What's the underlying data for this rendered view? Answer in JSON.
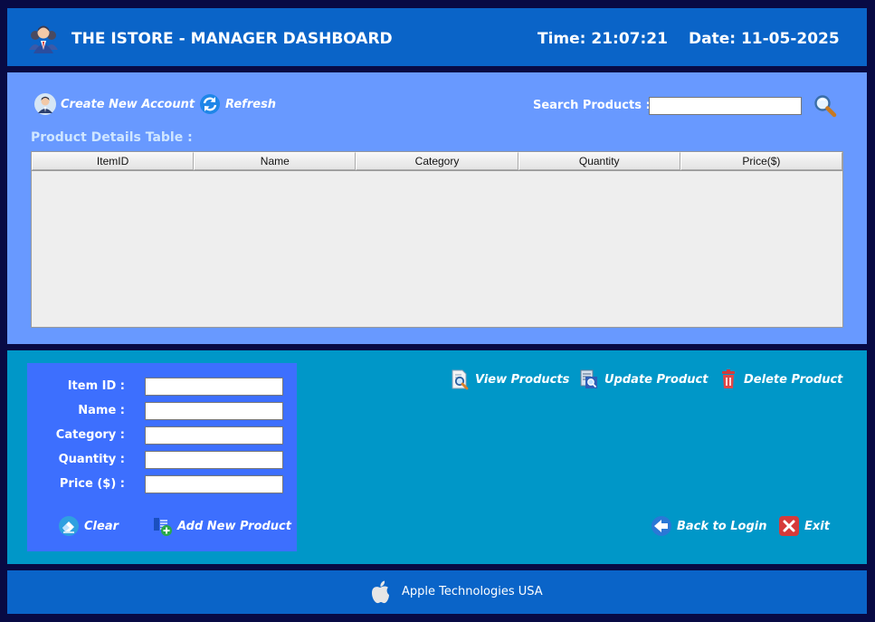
{
  "header": {
    "title": "THE ISTORE - MANAGER DASHBOARD",
    "time": "Time: 21:07:21",
    "date": "Date: 11-05-2025",
    "logo_icon": "manager-team-icon"
  },
  "toolbar": {
    "create_account_label": "Create New Account",
    "create_account_icon": "user-avatar-icon",
    "refresh_label": "Refresh",
    "refresh_icon": "refresh-icon",
    "search_label": "Search Products :",
    "search_value": "",
    "search_icon": "magnifier-icon"
  },
  "table": {
    "title": "Product Details Table :",
    "columns": [
      "ItemID",
      "Name",
      "Category",
      "Quantity",
      "Price($)"
    ],
    "rows": []
  },
  "form": {
    "item_id_label": "Item ID :",
    "name_label": "Name :",
    "category_label": "Category :",
    "quantity_label": "Quantity :",
    "price_label": "Price ($) :",
    "item_id_value": "",
    "name_value": "",
    "category_value": "",
    "quantity_value": "",
    "price_value": "",
    "clear_label": "Clear",
    "add_label": "Add New Product"
  },
  "actions": {
    "view_label": "View Products",
    "update_label": "Update Product",
    "delete_label": "Delete Product",
    "back_label": "Back to Login",
    "exit_label": "Exit"
  },
  "footer": {
    "company": "Apple Technologies USA",
    "logo_icon": "apple-logo-icon"
  },
  "colors": {
    "window_bg": "#080a44",
    "header_bg": "#0a64c8",
    "products_panel_bg": "#6899ff",
    "form_section_bg": "#0097c8",
    "form_panel_bg": "#3d6ffe",
    "table_bg": "#eeeeee"
  }
}
